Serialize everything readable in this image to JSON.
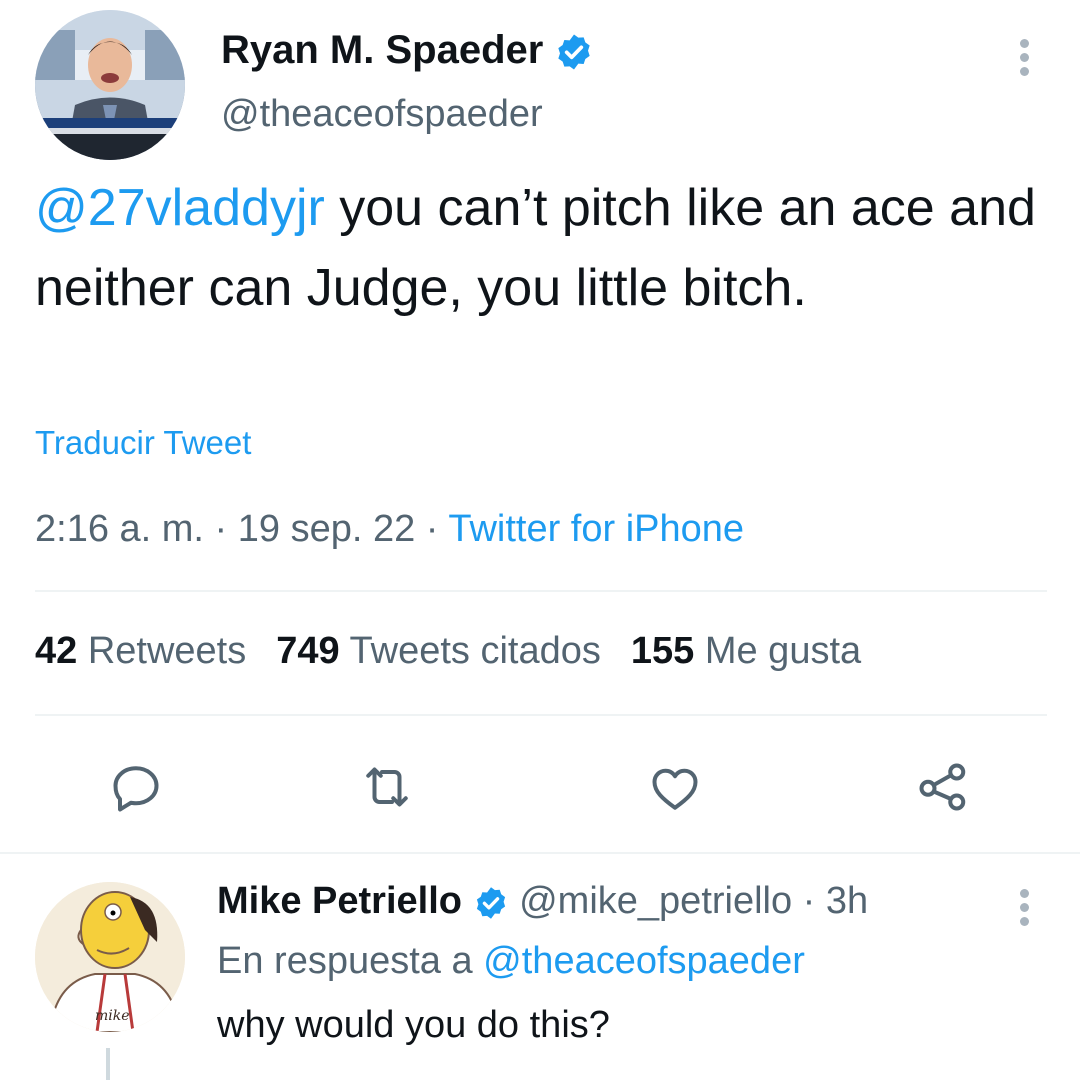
{
  "tweet": {
    "author_name": "Ryan M. Spaeder",
    "author_handle": "@theaceofspaeder",
    "mention": "@27vladdyjr",
    "text": " you can’t pitch like an ace and neither can Judge, you little bitch.",
    "translate_label": "Traducir Tweet",
    "time": "2:16 a. m.",
    "date": "19 sep. 22",
    "separator": " · ",
    "source": "Twitter for iPhone",
    "stats": {
      "retweets_count": "42",
      "retweets_label": " Retweets",
      "quotes_count": "749",
      "quotes_label": " Tweets citados",
      "likes_count": "155",
      "likes_label": " Me gusta"
    },
    "avatar_caption": "mike"
  },
  "actions": [
    "reply-icon",
    "retweet-icon",
    "like-icon",
    "share-icon"
  ],
  "reply": {
    "author_name": "Mike Petriello",
    "author_handle": "@mike_petriello",
    "separator": " · ",
    "time": "3h",
    "replying_prefix": "En respuesta a ",
    "replying_handle": "@theaceofspaeder",
    "text": "why would you do this?",
    "avatar_signature": "mike"
  },
  "colors": {
    "accent": "#1d9bf0",
    "text": "#0f1419",
    "secondary": "#536471",
    "divider": "#eff3f4"
  }
}
